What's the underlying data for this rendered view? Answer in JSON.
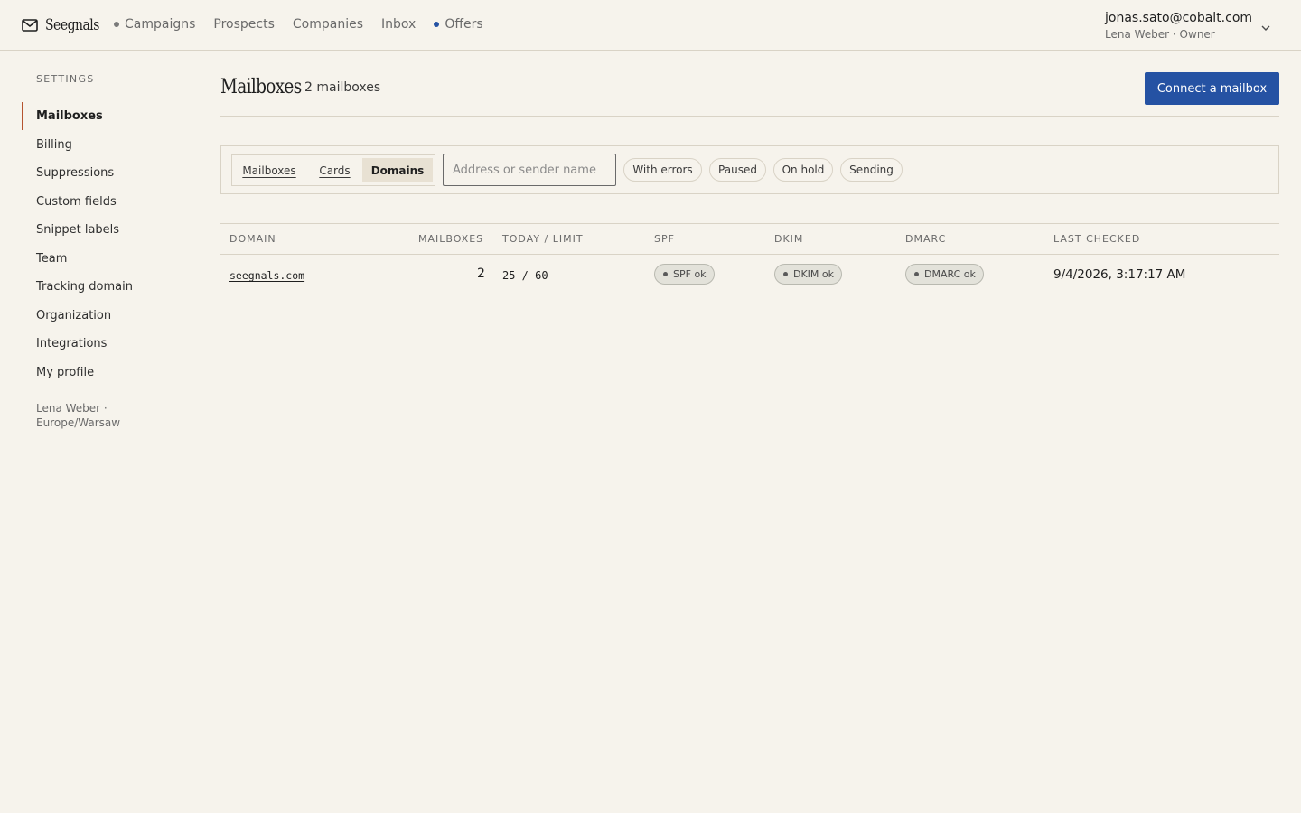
{
  "app": {
    "name": "Seegnals",
    "logo_icon": "envelope-icon"
  },
  "nav": {
    "items": [
      {
        "label": "Campaigns",
        "dot": "gray"
      },
      {
        "label": "Prospects"
      },
      {
        "label": "Companies"
      },
      {
        "label": "Inbox"
      },
      {
        "label": "Offers",
        "dot": "blue"
      }
    ]
  },
  "user": {
    "email": "jonas.sato@cobalt.com",
    "subtitle": "Lena Weber · Owner"
  },
  "sidebar": {
    "heading": "SETTINGS",
    "items": [
      {
        "label": "Mailboxes",
        "active": true
      },
      {
        "label": "Billing"
      },
      {
        "label": "Suppressions"
      },
      {
        "label": "Custom fields"
      },
      {
        "label": "Snippet labels"
      },
      {
        "label": "Team"
      },
      {
        "label": "Tracking domain"
      },
      {
        "label": "Organization"
      },
      {
        "label": "Integrations"
      },
      {
        "label": "My profile"
      }
    ],
    "footer": "Lena Weber · Europe/Warsaw"
  },
  "page": {
    "title": "Mailboxes",
    "count": "2 mailboxes",
    "connect_label": "Connect a mailbox"
  },
  "filters": {
    "views": [
      {
        "label": "Mailboxes"
      },
      {
        "label": "Cards"
      },
      {
        "label": "Domains",
        "active": true
      }
    ],
    "search_placeholder": "Address or sender name",
    "chips": [
      "With errors",
      "Paused",
      "On hold",
      "Sending"
    ]
  },
  "table": {
    "columns": [
      "DOMAIN",
      "MAILBOXES",
      "TODAY / LIMIT",
      "SPF",
      "DKIM",
      "DMARC",
      "LAST CHECKED"
    ],
    "rows": [
      {
        "domain": "seegnals.com",
        "mailboxes": "2",
        "today_limit": "25 / 60",
        "spf": "SPF ok",
        "dkim": "DKIM ok",
        "dmarc": "DMARC ok",
        "last_checked": "9/4/2026, 3:17:17 AM"
      }
    ]
  },
  "colors": {
    "background": "#f6f3ec",
    "accent": "#2552a3",
    "active_marker": "#b5532f"
  }
}
